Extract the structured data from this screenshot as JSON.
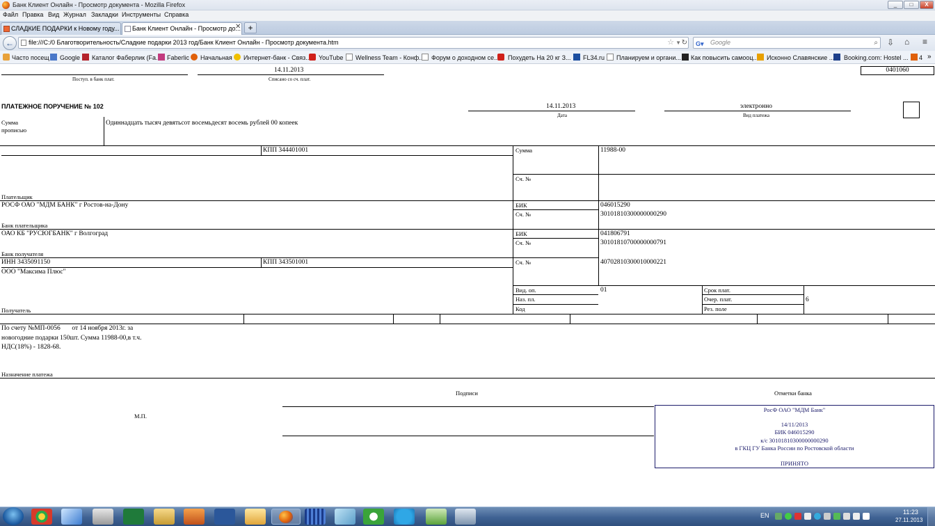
{
  "window": {
    "title": "Банк Клиент Онлайн - Просмотр документа - Mozilla Firefox",
    "min": "_",
    "max": "□",
    "close": "X"
  },
  "menu": [
    "Файл",
    "Правка",
    "Вид",
    "Журнал",
    "Закладки",
    "Инструменты",
    "Справка"
  ],
  "tabs": [
    {
      "label": "СЛАДКИЕ ПОДАРКИ к Новому году..."
    },
    {
      "label": "Банк Клиент Онлайн - Просмотр до..."
    }
  ],
  "tab_add": "+",
  "nav": {
    "url": "file:///C:/0 Благотворительность/Сладкие подарки 2013 год/Банк Клиент Онлайн - Просмотр документа.htm",
    "search_placeholder": "Google"
  },
  "bookmarks": [
    "Часто посещ",
    "Google",
    "Каталог Фаберлик (Fa...",
    "Faberlic",
    "Начальная",
    "Интернет-банк - Связ...",
    "YouTube",
    "Wellness Team - Конф...",
    "Форум о доходном се...",
    "Похудеть На 20 кг З...",
    "FL34.ru",
    "Планируем и органи...",
    "Как повысить самооц...",
    "Исконно Славянские ...",
    "Booking.com: Hostel ...",
    "4"
  ],
  "doc": {
    "received_label": "Поступ. в банк плат.",
    "written_off_date": "14.11.2013",
    "written_off_label": "Списано со сч. плат.",
    "form_code": "0401060",
    "title": "ПЛАТЕЖНОЕ ПОРУЧЕНИЕ № 102",
    "date": "14.11.2013",
    "date_label": "Дата",
    "payment_type": "электронно",
    "payment_type_label": "Вид платежа",
    "amount_words_label1": "Сумма",
    "amount_words_label2": "прописью",
    "amount_words": "Одиннадцать тысяч девятьсот восемьдесят восемь рублей 00 копеек",
    "payer_kpp": "КПП 344401001",
    "sum_label": "Сумма",
    "sum": "11988-00",
    "acc_label": "Сч. №",
    "payer_label": "Плательщик",
    "payer_bank": "РОСФ ОАО \"МДМ БАНК\" г Ростов-на-Дону",
    "bik_label": "БИК",
    "payer_bik": "046015290",
    "payer_bank_acc": "30101810300000000290",
    "payer_bank_label": "Банк плательщика",
    "recipient_bank": "ОАО КБ \"РУСЮГБАНК\" г Волгоград",
    "recipient_bik": "041806791",
    "recipient_bank_acc": "30101810700000000791",
    "recipient_bank_label": "Банк получателя",
    "recipient_inn": "ИНН 3435091150",
    "recipient_kpp": "КПП 343501001",
    "recipient_acc": "40702810300010000221",
    "recipient_name": "ООО \"Максима Плюс\"",
    "recipient_label": "Получатель",
    "vid_op_label": "Вид. оп.",
    "vid_op": "01",
    "naz_pl_label": "Наз. пл.",
    "kod_label": "Код",
    "srok_label": "Срок плат.",
    "ocher_label": "Очер. плат.",
    "ocher": "6",
    "rez_label": "Рез. поле",
    "purpose_line1": "По счету №МП-0056       от 14 ноября 2013г. за",
    "purpose_line2": "новогодние подарки 150шт. Сумма 11988-00,в т.ч.",
    "purpose_line3": "НДС(18%) - 1828-68.",
    "purpose_label": "Назначение платежа",
    "signatures_label": "Подписи",
    "bank_marks_label": "Отметки банка",
    "mp_label": "М.П.",
    "stamp": {
      "line1": "РосФ ОАО \"МДМ Банк\"",
      "line2": "14/11/2013",
      "line3": "БИК 046015290",
      "line4": "к/с 30101810300000000290",
      "line5": "в ГКЦ ГУ Банка России по Ростовской области",
      "line6": "ПРИНЯТО"
    }
  },
  "taskbar": {
    "lang": "EN",
    "time": "11:23",
    "date": "27.11.2013"
  },
  "colors": {
    "stamp": "#1b1b6a",
    "taskbar": "#3f6293",
    "tabbar": "#c6d3e6"
  }
}
